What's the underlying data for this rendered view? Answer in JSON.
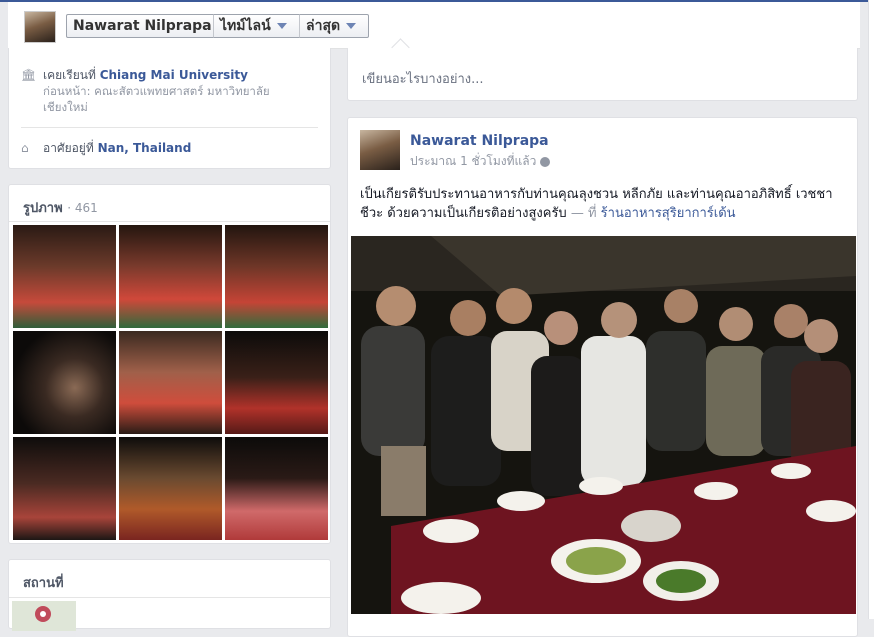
{
  "header": {
    "name": "Nawarat Nilprapa",
    "timeline_label": "ไทม์ไลน์",
    "recent_label": "ล่าสุด"
  },
  "about": {
    "studied_prefix": "เคยเรียนที่",
    "studied_school": "Chiang Mai University",
    "studied_sub": "ก่อนหน้า: คณะสัตวแพทยศาสตร์ มหาวิทยาลัยเชียงใหม่",
    "lives_prefix": "อาศัยอยู่ที่",
    "lives_place": "Nan, Thailand"
  },
  "photos": {
    "title": "รูปภาพ",
    "count": "· 461"
  },
  "places": {
    "title": "สถานที่"
  },
  "composer": {
    "placeholder": "เขียนอะไรบางอย่าง..."
  },
  "post": {
    "author": "Nawarat Nilprapa",
    "time": "ประมาณ 1 ชั่วโมงที่แล้ว",
    "text": "เป็นเกียรติรับประทานอาหารกับท่านคุณลุงชวน หลีกภัย และท่านคุณอาอภิสิทธิ์ เวชชาชีวะ ด้วยความเป็นเกียรติอย่างสูงครับ",
    "at_label": "— ที่",
    "place": "ร้านอาหารสุริยาการ์เด้น"
  },
  "colors": {
    "link": "#3b5998",
    "muted": "#9197a3",
    "page_bg": "#e9eaed"
  }
}
